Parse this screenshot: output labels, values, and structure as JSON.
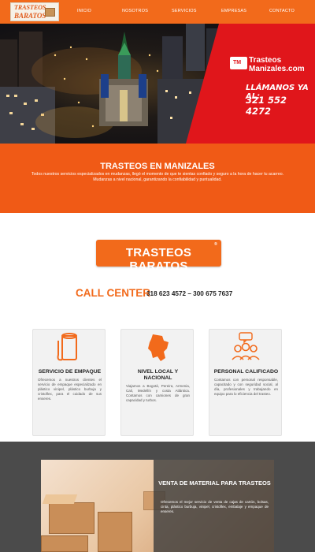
{
  "nav": {
    "logo_line1": "TRASTEOS",
    "logo_line2": "BARATOS",
    "items": [
      {
        "label": "INICIO"
      },
      {
        "label": "NOSOTROS"
      },
      {
        "label": "SERVICIOS"
      },
      {
        "label": "EMPRESAS"
      },
      {
        "label": "CONTACTO"
      }
    ]
  },
  "hero": {
    "badge": "TM",
    "brand_line1": "Trasteos",
    "brand_line2": "Manizales.com",
    "call_label": "LLÁMANOS YA AL:",
    "phone": "321 552 4272"
  },
  "band": {
    "title": "TRASTEOS EN MANIZALES",
    "text": "Todos nuestros servicios especializados en mudanzas, llegó el momento de que te sientas confiado y seguro a la hora de hacer tu acarreo. Mudanzas a nivel nacional, garantizando la confiabilidad y puntualidad."
  },
  "brand_logo": {
    "text": "TRASTEOS BARATOS",
    "mark": "®"
  },
  "call_center": {
    "label": "CALL CENTER",
    "numbers": "318 623 4572 – 300 675 7637"
  },
  "services": [
    {
      "icon": "paper-roll-icon",
      "title": "SERVICIO DE EMPAQUE",
      "text": "Ofrecemos a nuestros clientes el servicio de empaque especializado en plástico vinipel, plástico burbuja y cristoflex, para el cuidado de sus enseres."
    },
    {
      "icon": "colombia-map-icon",
      "title": "NIVEL LOCAL Y NACIONAL",
      "text": "Viajamos a Bogotá, Pereira, Armenia, Cali, Medellín y costa Atlántica. Contamos con camiones de gran capacidad y turbos."
    },
    {
      "icon": "team-chat-icon",
      "title": "PERSONAL CALIFICADO",
      "text": "Contamos con personal responsable, capacitado y con seguridad social, al día, profesionales y trabajando en equipo para lo eficiencia del trasteo."
    }
  ],
  "material": {
    "title": "VENTA DE MATERIAL PARA TRASTEOS",
    "text": "Ofrecemos el mejor servicio de venta de cajas de cartón, bolsas, cinta, plástico burbuja, vinipel, cristoflex, embalaje y empaque de enseres."
  },
  "colors": {
    "primary_orange": "#f26a1b",
    "band_orange": "#f05a16",
    "hero_red": "#e0161b",
    "dark_section": "#4b4b4b"
  }
}
